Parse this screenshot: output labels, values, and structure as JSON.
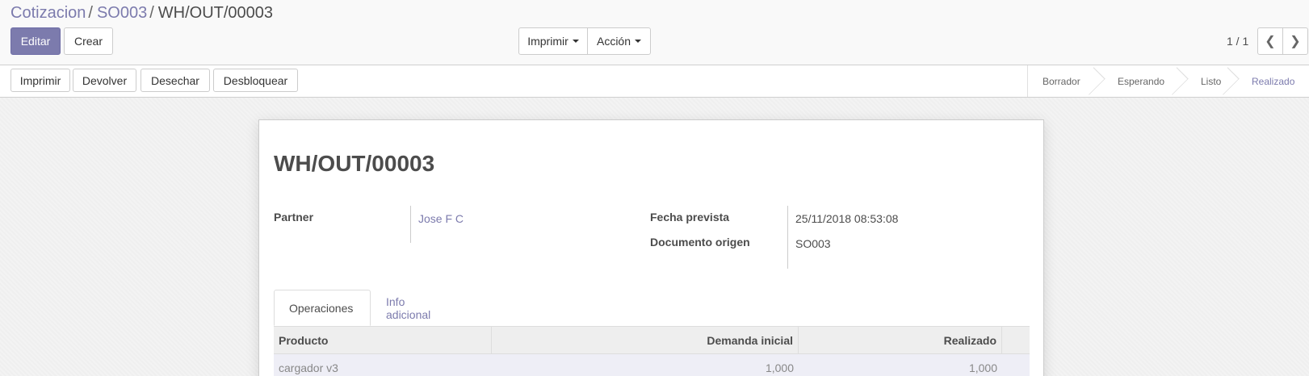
{
  "breadcrumb": {
    "items": [
      "Cotizacion",
      "SO003"
    ],
    "separator": "/",
    "current": "WH/OUT/00003"
  },
  "toolbar": {
    "edit_label": "Editar",
    "create_label": "Crear",
    "print_label": "Imprimir",
    "action_label": "Acción"
  },
  "pager": {
    "value": "1 / 1",
    "prev_icon": "chevron-left-icon",
    "next_icon": "chevron-right-icon"
  },
  "statusbar": {
    "buttons": [
      "Imprimir",
      "Devolver",
      "Desechar",
      "Desbloquear"
    ],
    "stages": [
      "Borrador",
      "Esperando",
      "Listo",
      "Realizado"
    ],
    "active_stage": "Realizado"
  },
  "record": {
    "title": "WH/OUT/00003",
    "partner_label": "Partner",
    "partner_value": "Jose F C",
    "scheduled_label": "Fecha prevista",
    "scheduled_value": "25/11/2018 08:53:08",
    "origin_label": "Documento origen",
    "origin_value": "SO003"
  },
  "tabs": [
    {
      "label": "Operaciones",
      "active": true
    },
    {
      "label": "Info adicional",
      "active": false
    }
  ],
  "table": {
    "columns": [
      "Producto",
      "Demanda inicial",
      "Realizado"
    ],
    "rows": [
      [
        "cargador v3",
        "1,000",
        "1,000"
      ]
    ]
  },
  "colors": {
    "primary": "#7c7bad",
    "text": "#4c4c4c"
  }
}
